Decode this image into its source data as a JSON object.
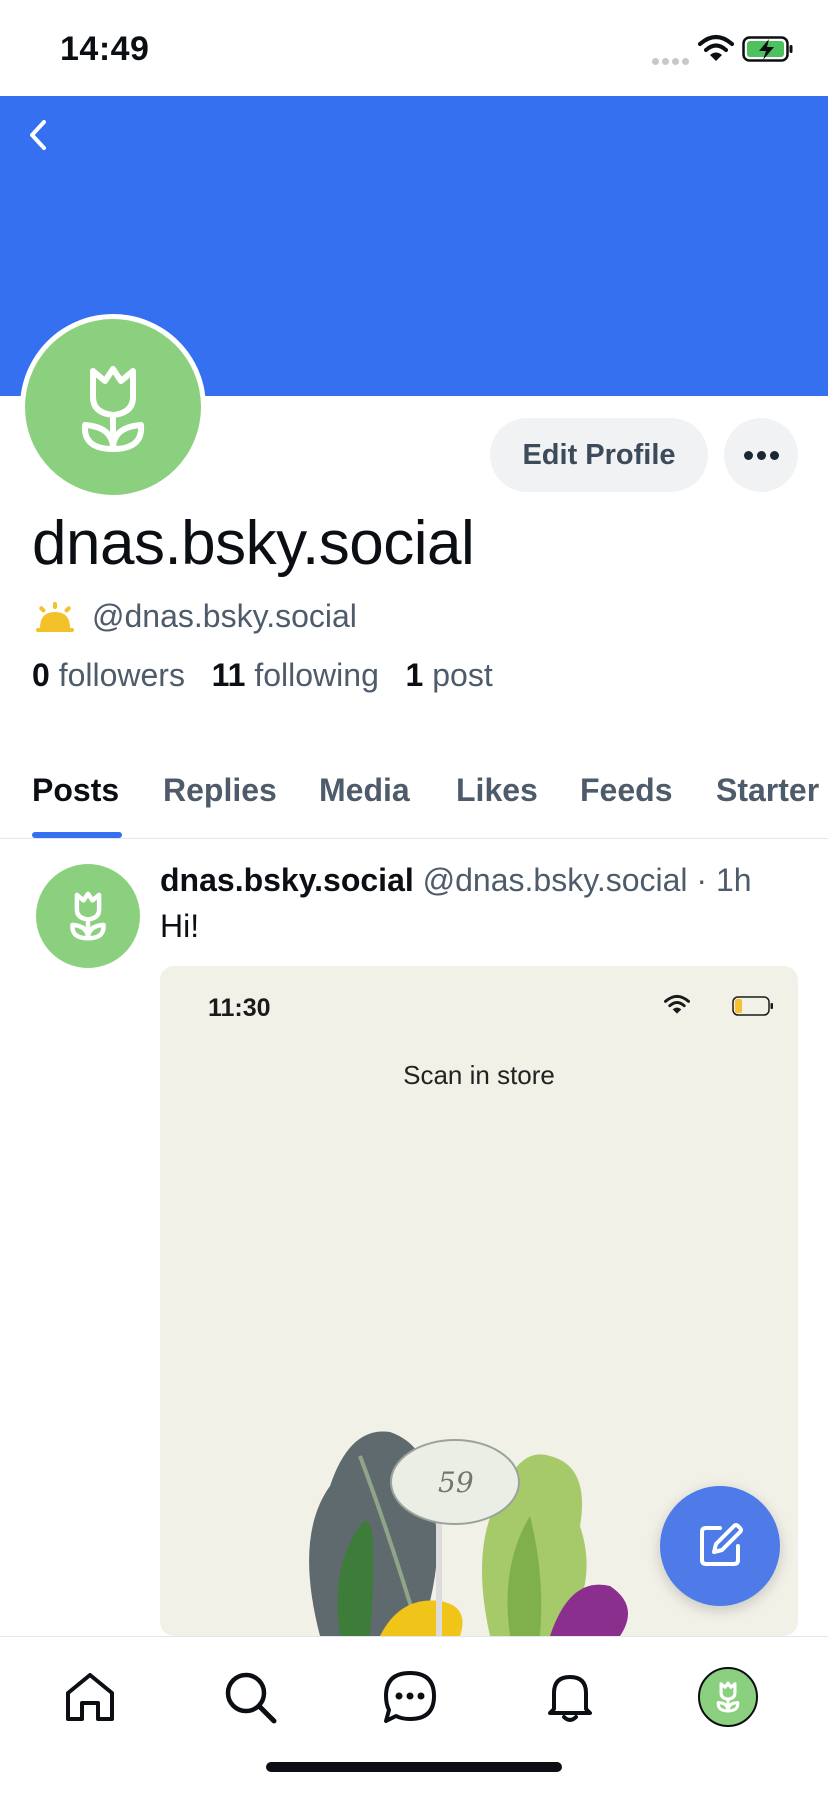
{
  "status_bar": {
    "time": "14:49"
  },
  "profile": {
    "display_name": "dnas.bsky.social",
    "handle": "@dnas.bsky.social",
    "followers_count": "0",
    "followers_label": "followers",
    "following_count": "11",
    "following_label": "following",
    "posts_count": "1",
    "posts_label": "post",
    "edit_button": "Edit Profile",
    "banner_color": "#3470f0",
    "avatar_color": "#8bd07f"
  },
  "tabs": [
    {
      "label": "Posts",
      "active": true
    },
    {
      "label": "Replies"
    },
    {
      "label": "Media"
    },
    {
      "label": "Likes"
    },
    {
      "label": "Feeds"
    },
    {
      "label": "Starter"
    }
  ],
  "post": {
    "author_name": "dnas.bsky.social",
    "author_handle": "@dnas.bsky.social",
    "separator": "·",
    "age": "1h",
    "text": "Hi!",
    "image": {
      "time": "11:30",
      "title": "Scan in store",
      "tag_text": "59"
    }
  },
  "icons": {
    "back": "chevron-left-icon",
    "more": "ellipsis-icon",
    "compose": "compose-icon",
    "nav": [
      "home-icon",
      "search-icon",
      "chat-icon",
      "bell-icon",
      "profile-avatar-icon"
    ]
  },
  "colors": {
    "accent": "#3470f0",
    "fab": "#4f7be8",
    "muted_text": "#4e5b6b"
  }
}
